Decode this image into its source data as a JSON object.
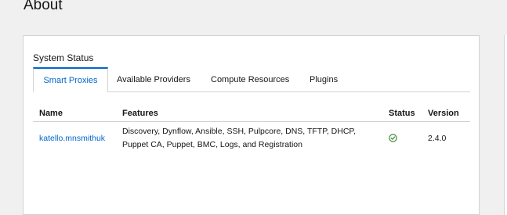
{
  "page": {
    "title": "About"
  },
  "card": {
    "title": "System Status"
  },
  "tabs": [
    {
      "label": "Smart Proxies",
      "active": true
    },
    {
      "label": "Available Providers",
      "active": false
    },
    {
      "label": "Compute Resources",
      "active": false
    },
    {
      "label": "Plugins",
      "active": false
    }
  ],
  "table": {
    "headers": {
      "name": "Name",
      "features": "Features",
      "status": "Status",
      "version": "Version"
    },
    "rows": [
      {
        "name": "katello.mnsmithuk",
        "features_line1": "Discovery, Dynflow, Ansible, SSH, Pulpcore, DNS, TFTP, DHCP,",
        "features_line2": "Puppet CA, Puppet, BMC, Logs, and Registration",
        "status_icon": "check-circle-icon",
        "status_color": "#3e8635",
        "version": "2.4.0"
      }
    ]
  }
}
